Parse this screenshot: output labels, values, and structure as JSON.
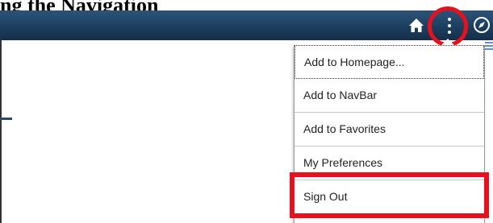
{
  "page": {
    "heading_fragment": "ng the Navigation"
  },
  "header": {
    "home_icon": "home-icon",
    "actions_icon": "vertical-ellipsis-icon",
    "navbar_icon": "compass-icon",
    "bar_color": "#1c3f5f"
  },
  "actions_menu": {
    "items": [
      {
        "label": "Add to Homepage..."
      },
      {
        "label": "Add to NavBar"
      },
      {
        "label": "Add to Favorites"
      },
      {
        "label": "My Preferences"
      },
      {
        "label": "Sign Out"
      }
    ]
  },
  "annotations": {
    "highlight_color": "#e8101c"
  }
}
